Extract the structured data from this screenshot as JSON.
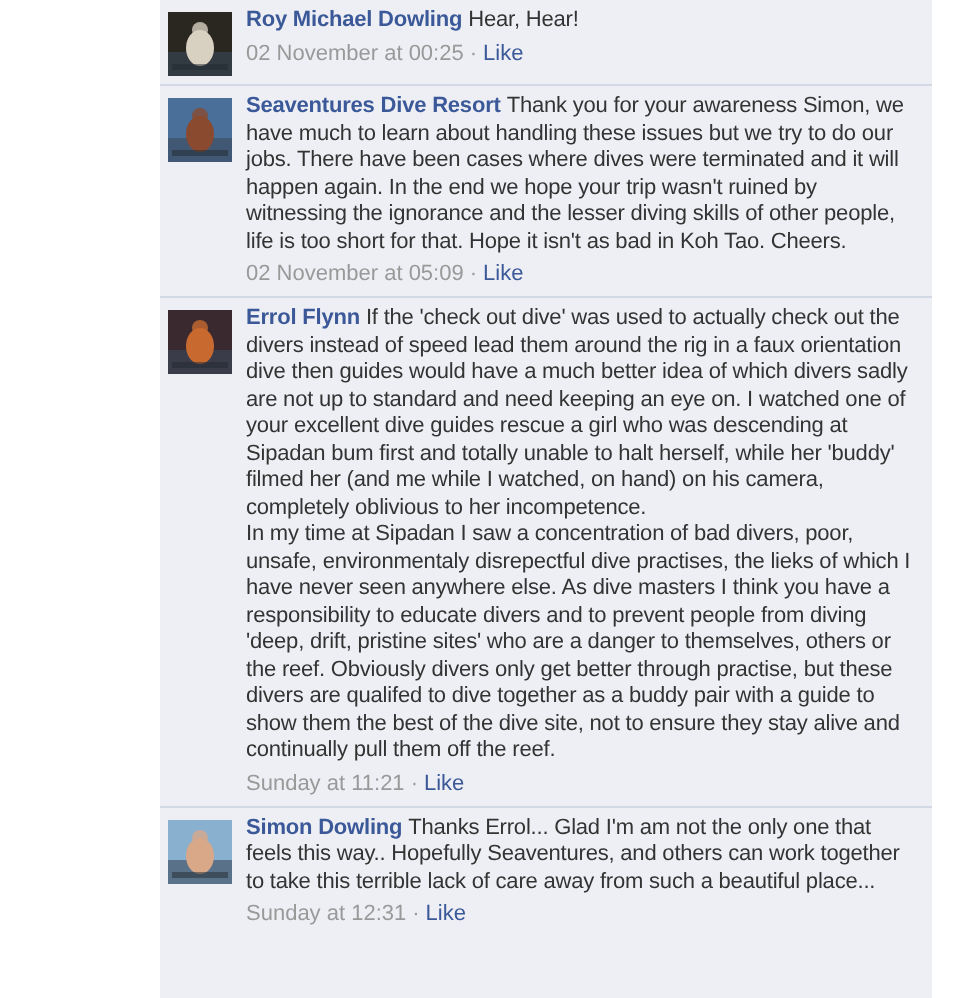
{
  "comments": [
    {
      "author": "Roy Michael Dowling",
      "paragraphs": [
        "Hear, Hear!"
      ],
      "time": "02 November at 00:25",
      "separator": "·",
      "like": "Like",
      "avatar": {
        "kind": "picture"
      }
    },
    {
      "author": "Seaventures Dive Resort",
      "paragraphs": [
        "Thank you for your awareness Simon, we have much to learn about handling these issues but we try to do our jobs. There have been cases where dives were terminated and it will happen again. In the end we hope your trip wasn't ruined by witnessing the ignorance and the lesser diving skills of other people, life is too short for that. Hope it isn't as bad in Koh Tao. Cheers."
      ],
      "time": "02 November at 05:09",
      "separator": "·",
      "like": "Like",
      "avatar": {
        "kind": "picture"
      }
    },
    {
      "author": "Errol Flynn",
      "paragraphs": [
        "If the 'check out dive' was used to actually check out the divers instead of speed lead them around the rig in a faux orientation dive then guides would have a much better idea of which divers sadly are not up to standard and need keeping an eye on. I watched one of your excellent dive guides rescue a girl who was descending at Sipadan bum first and totally unable to halt herself, while her 'buddy' filmed her (and me while I watched, on hand) on his camera, completely oblivious to her incompetence.",
        "In my time at Sipadan I saw a concentration of bad divers, poor, unsafe, environmentaly disrepectful dive practises, the lieks of which I have never seen anywhere else. As dive masters I think you have a responsibility to educate divers and to prevent people from diving 'deep, drift, pristine sites' who are a danger to themselves, others or the reef. Obviously divers only get better through practise, but these divers are qualifed to dive together as a buddy pair with a guide to show them the best of the dive site, not to ensure they stay alive and continually pull them off the reef."
      ],
      "time": "Sunday at 11:21",
      "separator": "·",
      "like": "Like",
      "avatar": {
        "kind": "picture"
      }
    },
    {
      "author": "Simon Dowling",
      "paragraphs": [
        "Thanks Errol... Glad I'm am not the only one that feels this way.. Hopefully Seaventures, and others can work together to take this terrible lack of care away from such a beautiful place..."
      ],
      "time": "Sunday at 12:31",
      "separator": "·",
      "like": "Like",
      "avatar": {
        "kind": "picture"
      }
    }
  ]
}
